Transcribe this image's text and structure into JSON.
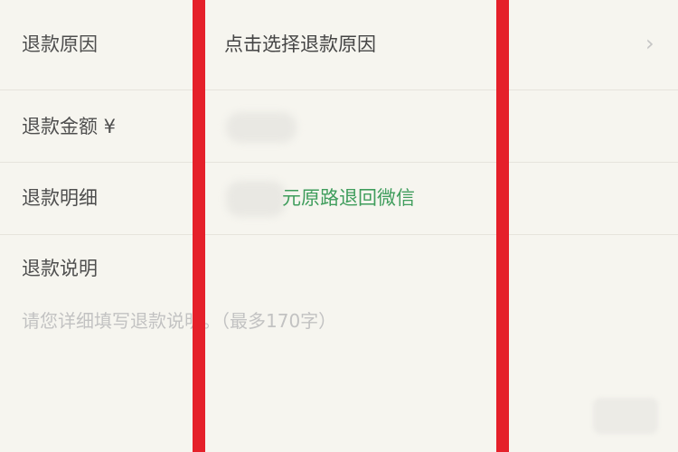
{
  "refund_form": {
    "reason": {
      "label": "退款原因",
      "value": "点击选择退款原因",
      "chevron": "›"
    },
    "amount": {
      "label": "退款金额 ¥"
    },
    "detail": {
      "label": "退款明细",
      "value": "元原路退回微信"
    },
    "description": {
      "label": "退款说明",
      "placeholder": "请您详细填写退款说明。（最多170字）"
    }
  },
  "annotation": {
    "color": "#e5202a"
  },
  "theme": {
    "background": "#f6f5ef",
    "accent_green": "#3f9d5c"
  }
}
